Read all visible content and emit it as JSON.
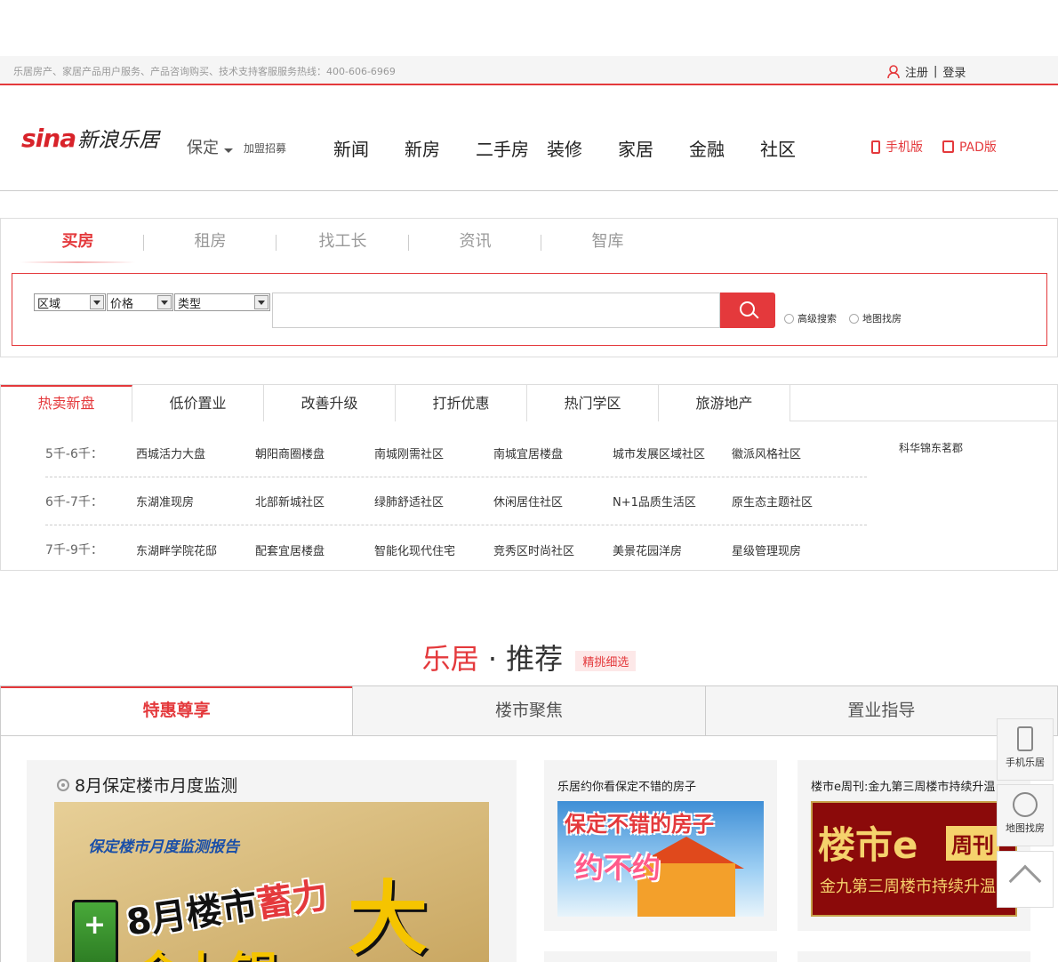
{
  "topbar": {
    "hotline": "乐居房产、家居产品用户服务、产品咨询购买、技术支持客服服务热线：400-606-6969",
    "register": "注册",
    "divider": "|",
    "login": "登录"
  },
  "header": {
    "logo_sina": "sina",
    "logo_cn": "新浪乐居",
    "city": "保定",
    "join": "加盟招募",
    "nav": [
      "新闻",
      "新房",
      "二手房",
      "装修",
      "家居",
      "金融",
      "社区"
    ],
    "mobile": "手机版",
    "pad": "PAD版"
  },
  "search": {
    "tabs": [
      "买房",
      "租房",
      "找工长",
      "资讯",
      "智库"
    ],
    "active_tab": "买房",
    "selects": [
      "区域",
      "价格",
      "类型"
    ],
    "query": "",
    "advanced": "高级搜索",
    "map": "地图找房"
  },
  "hot": {
    "tabs": [
      "热卖新盘",
      "低价置业",
      "改善升级",
      "打折优惠",
      "热门学区",
      "旅游地产"
    ],
    "rows": [
      {
        "price": "5千-6千：",
        "items": [
          "西城活力大盘",
          "朝阳商圈楼盘",
          "南城刚需社区",
          "南城宜居楼盘",
          "城市发展区域社区",
          "徽派风格社区"
        ]
      },
      {
        "price": "6千-7千：",
        "items": [
          "东湖准现房",
          "北部新城社区",
          "绿肺舒适社区",
          "休闲居住社区",
          "N+1品质生活区",
          "原生态主题社区"
        ]
      },
      {
        "price": "7千-9千：",
        "items": [
          "东湖畔学院花邸",
          "配套宜居楼盘",
          "智能化现代住宅",
          "竞秀区时尚社区",
          "美景花园洋房",
          "星级管理现房"
        ]
      }
    ],
    "side_link": "科华锦东茗郡"
  },
  "recommend": {
    "title_red": "乐居",
    "dot": "·",
    "title_dark": "推荐",
    "tag": "精挑细选",
    "tabs": [
      "特惠尊享",
      "楼市聚焦",
      "置业指导"
    ],
    "big_card": {
      "title": "8月保定楼市月度监测",
      "poster_brand": "保定楼市月度监测报告",
      "poster_head_a": "8月楼市",
      "poster_head_b": "蓄力",
      "poster_big": "大",
      "poster_bottom": "金九银"
    },
    "card1": {
      "title": "乐居约你看保定不错的房子",
      "img_line1": "保定不错的房子",
      "img_line2": "约不约"
    },
    "card2": {
      "title": "楼市e周刊:金九第三周楼市持续升温",
      "img_line1": "楼市e",
      "img_line2": "周刊",
      "img_line3": "金九第三周楼市持续升温"
    }
  },
  "float": {
    "mobile": "手机乐居",
    "map": "地图找房"
  },
  "colors": {
    "accent": "#e4393c",
    "border": "#dddddd"
  }
}
